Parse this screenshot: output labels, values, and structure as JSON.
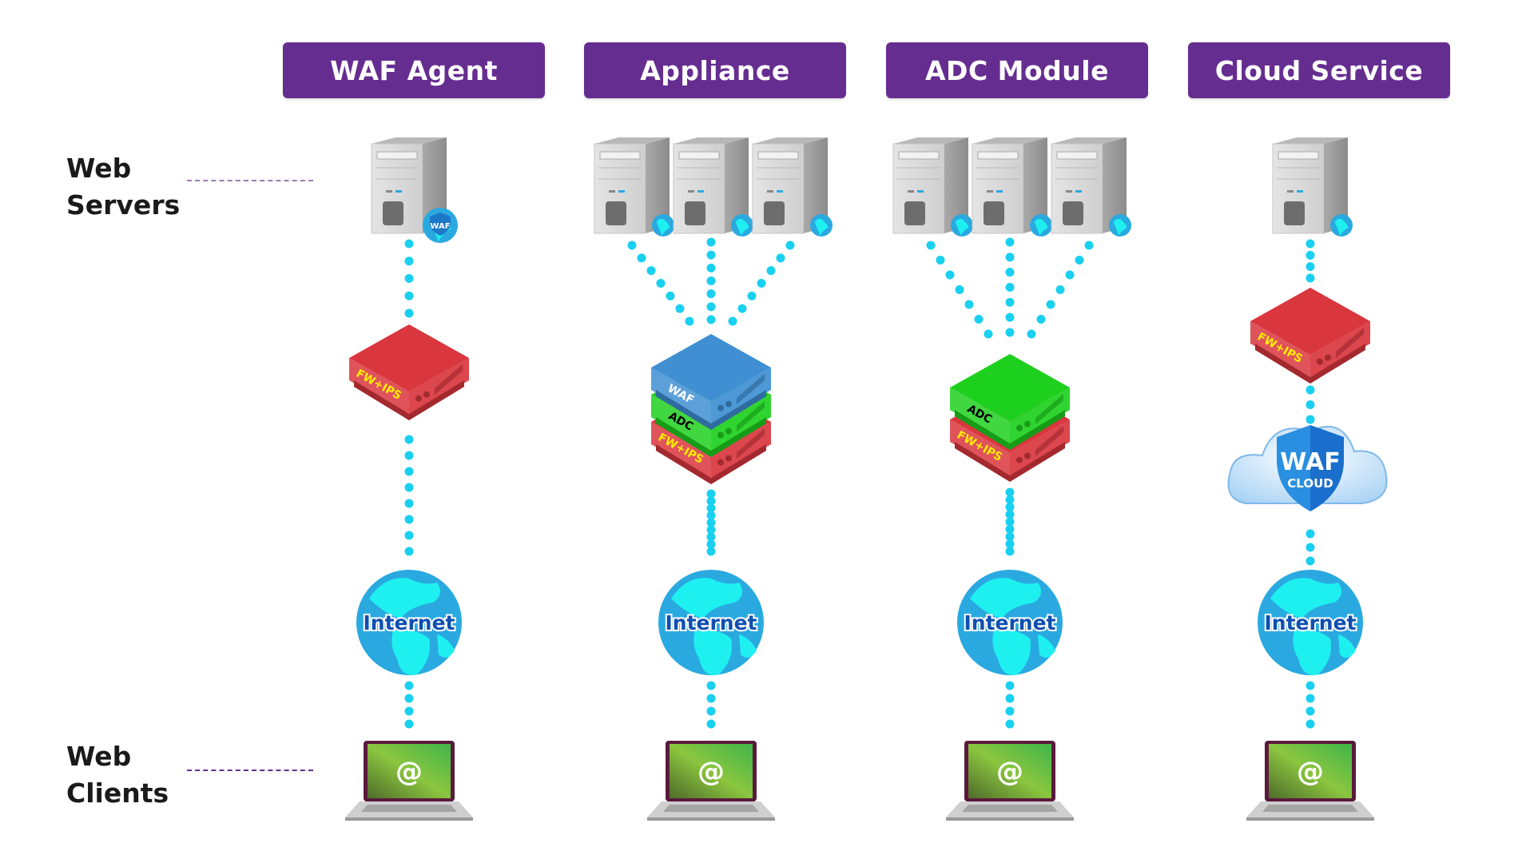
{
  "columns": [
    {
      "title": "WAF Agent",
      "servers": 1,
      "server_badge": "WAF",
      "devices": [
        "FW+IPS"
      ],
      "cloud": null,
      "network": "Internet"
    },
    {
      "title": "Appliance",
      "servers": 3,
      "server_badge": null,
      "devices": [
        "WAF",
        "ADC",
        "FW+IPS"
      ],
      "cloud": null,
      "network": "Internet"
    },
    {
      "title": "ADC Module",
      "servers": 3,
      "server_badge": null,
      "devices": [
        "ADC",
        "FW+IPS"
      ],
      "cloud": null,
      "network": "Internet"
    },
    {
      "title": "Cloud Service",
      "servers": 1,
      "server_badge": null,
      "devices": [
        "FW+IPS"
      ],
      "cloud": {
        "line1": "WAF",
        "line2": "CLOUD"
      },
      "network": "Internet"
    }
  ],
  "row_labels": {
    "servers": {
      "line1": "Web",
      "line2": "Servers"
    },
    "clients": {
      "line1": "Web",
      "line2": "Clients"
    }
  },
  "client_symbol": "@",
  "colors": {
    "header_bg": "#662d91",
    "connector": "#19d0f0",
    "fw_ips": "#d9363e",
    "waf_device": "#3f8fd2",
    "adc_device": "#1ed01e",
    "globe": "#2aa9e0",
    "globe_land": "#1ef0f0",
    "laptop_screen": "#7cc242"
  }
}
